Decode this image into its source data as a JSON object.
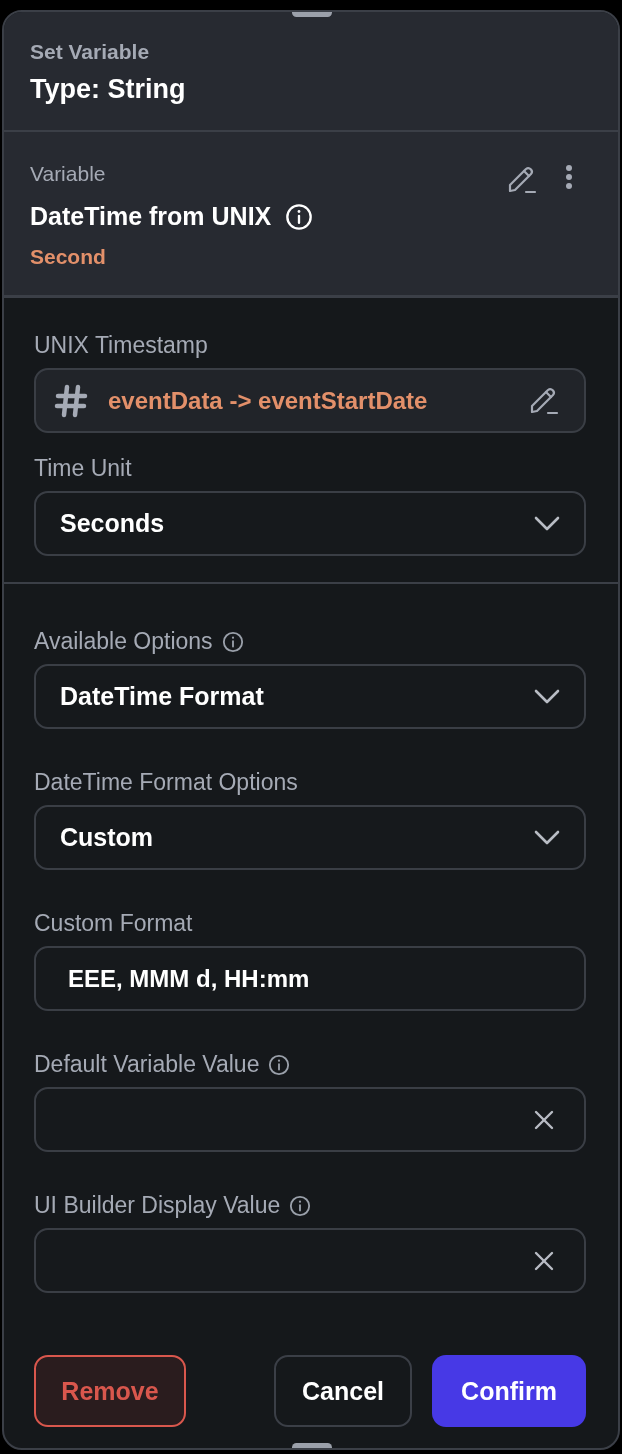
{
  "header": {
    "subtitle": "Set Variable",
    "title": "Type: String"
  },
  "variable": {
    "label": "Variable",
    "name": "DateTime from UNIX",
    "unit": "Second",
    "info": true
  },
  "sections": [
    {
      "fields": [
        {
          "label": "UNIX Timestamp",
          "kind": "variable",
          "value": "eventData -> eventStartDate",
          "info": false
        },
        {
          "label": "Time Unit",
          "kind": "select",
          "value": "Seconds",
          "info": false
        }
      ]
    },
    {
      "fields": [
        {
          "label": "Available Options",
          "kind": "select",
          "value": "DateTime Format",
          "info": true
        },
        {
          "label": "DateTime Format Options",
          "kind": "select",
          "value": "Custom",
          "info": false
        },
        {
          "label": "Custom Format",
          "kind": "text",
          "value": "EEE, MMM d, HH:mm",
          "info": false
        },
        {
          "label": "Default Variable Value",
          "kind": "clearable",
          "info": true
        },
        {
          "label": "UI Builder Display Value",
          "kind": "clearable",
          "info": true
        }
      ]
    }
  ],
  "buttons": [
    {
      "label": "Remove",
      "kind": "danger"
    },
    {
      "label": "Cancel",
      "kind": "secondary"
    },
    {
      "label": "Confirm",
      "kind": "primary"
    }
  ]
}
